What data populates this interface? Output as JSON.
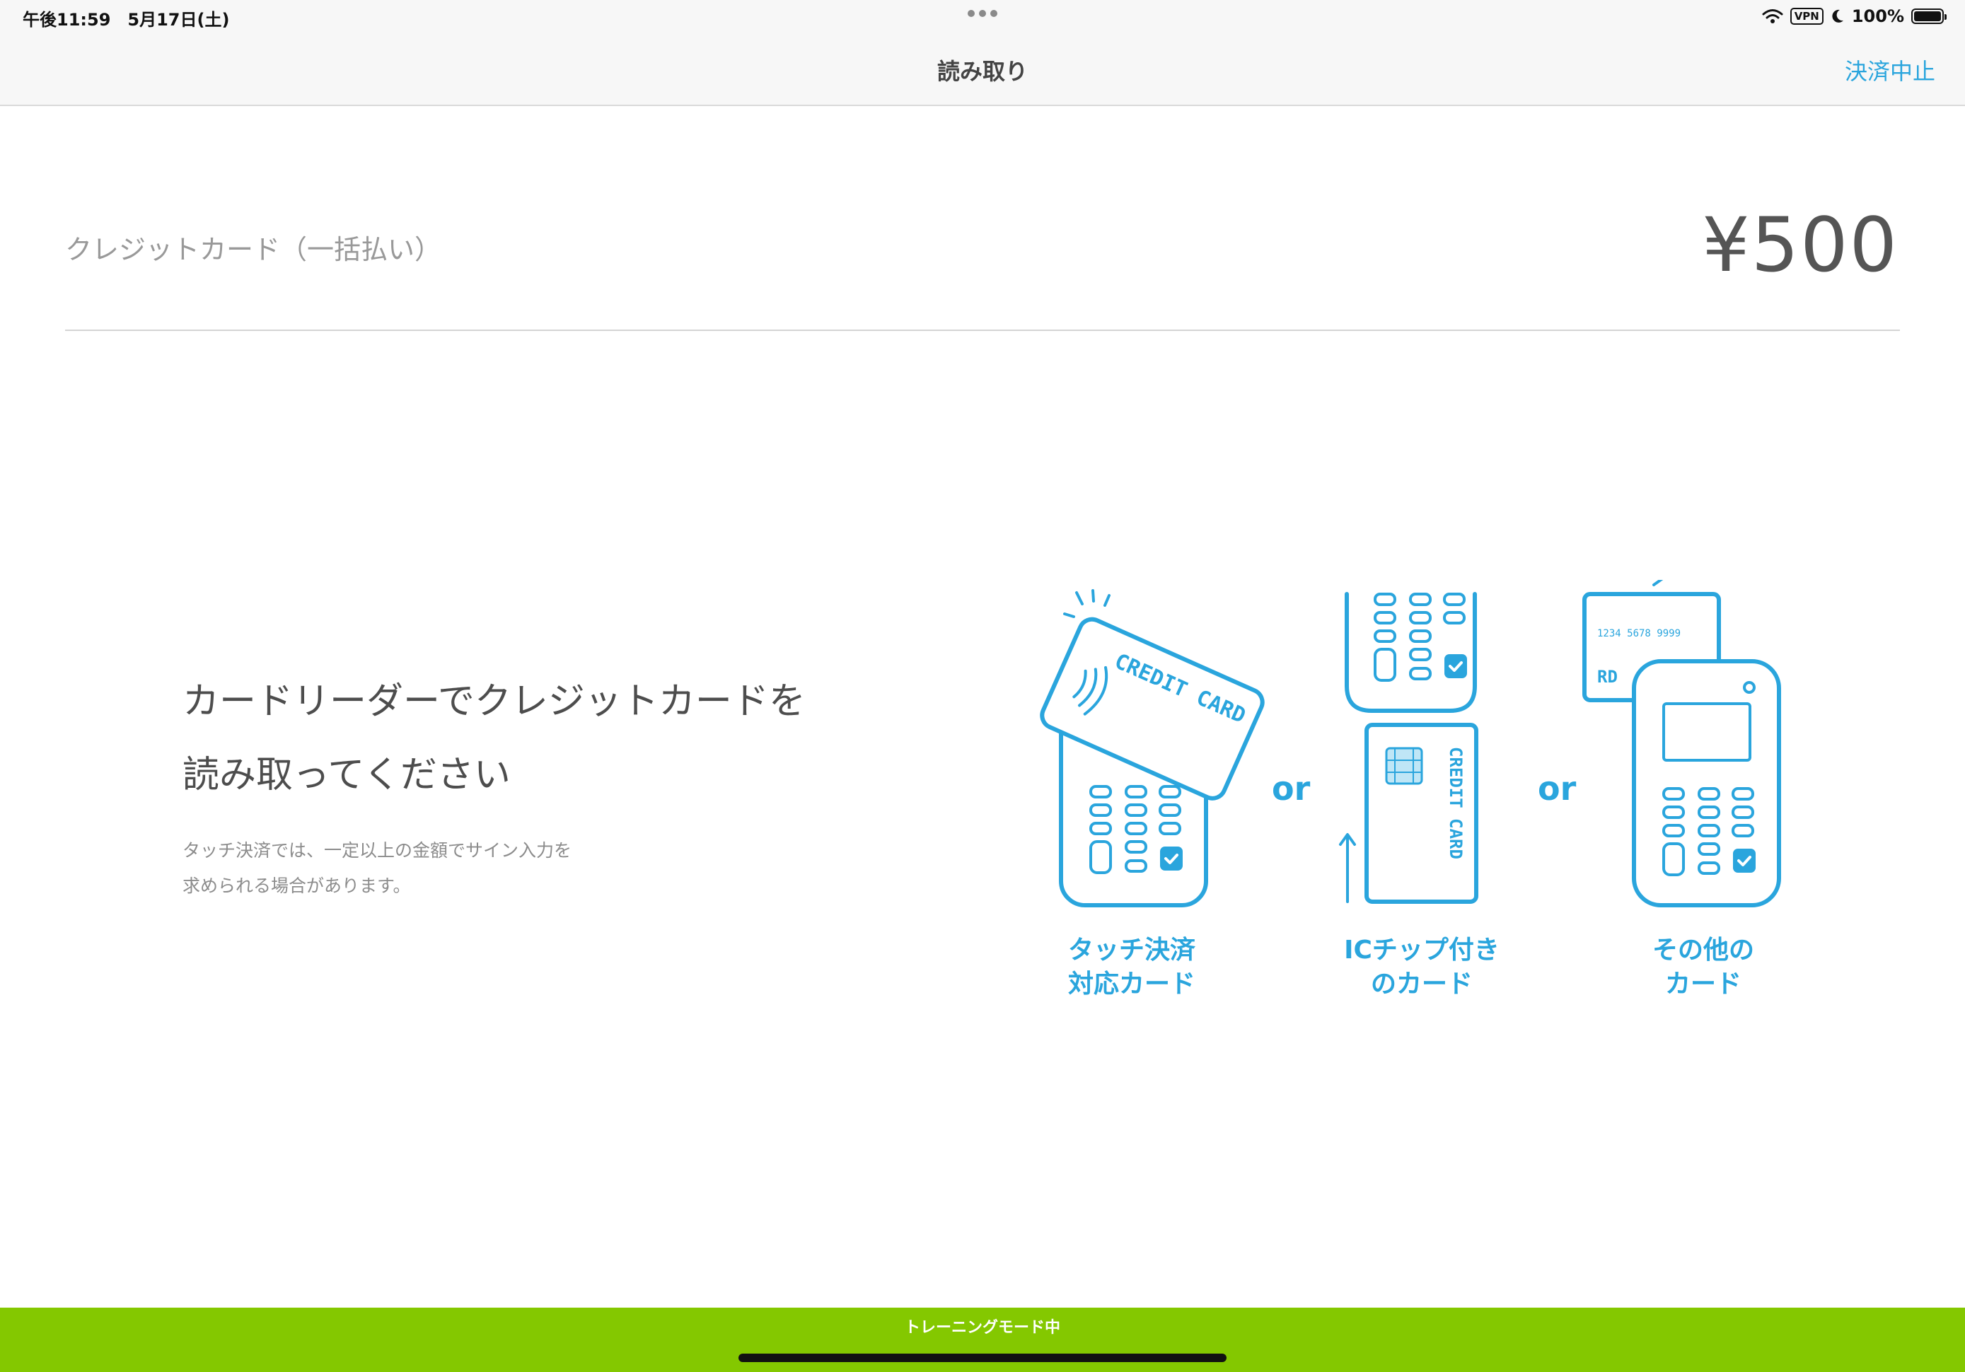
{
  "status_bar": {
    "time_date": "午後11:59　5月17日(土)",
    "vpn": "VPN",
    "battery": "100%"
  },
  "nav": {
    "title": "読み取り",
    "cancel": "決済中止"
  },
  "payment": {
    "method": "クレジットカード（一括払い）",
    "amount": "¥500"
  },
  "instructions": {
    "line1": "カードリーダーでクレジットカードを",
    "line2": "読み取ってください",
    "note1": "タッチ決済では、一定以上の金額でサイン入力を",
    "note2": "求められる場合があります。"
  },
  "illustration": {
    "card_text": "CREDIT CARD",
    "card_number": "1234 5678 9999",
    "or": "or",
    "options": [
      {
        "line1": "タッチ決済",
        "line2": "対応カード"
      },
      {
        "line1": "ICチップ付き",
        "line2": "のカード"
      },
      {
        "line1": "その他の",
        "line2": "カード"
      }
    ],
    "accent_color": "#2aa5dd"
  },
  "footer": {
    "training": "トレーニングモード中",
    "training_color": "#84c800"
  }
}
